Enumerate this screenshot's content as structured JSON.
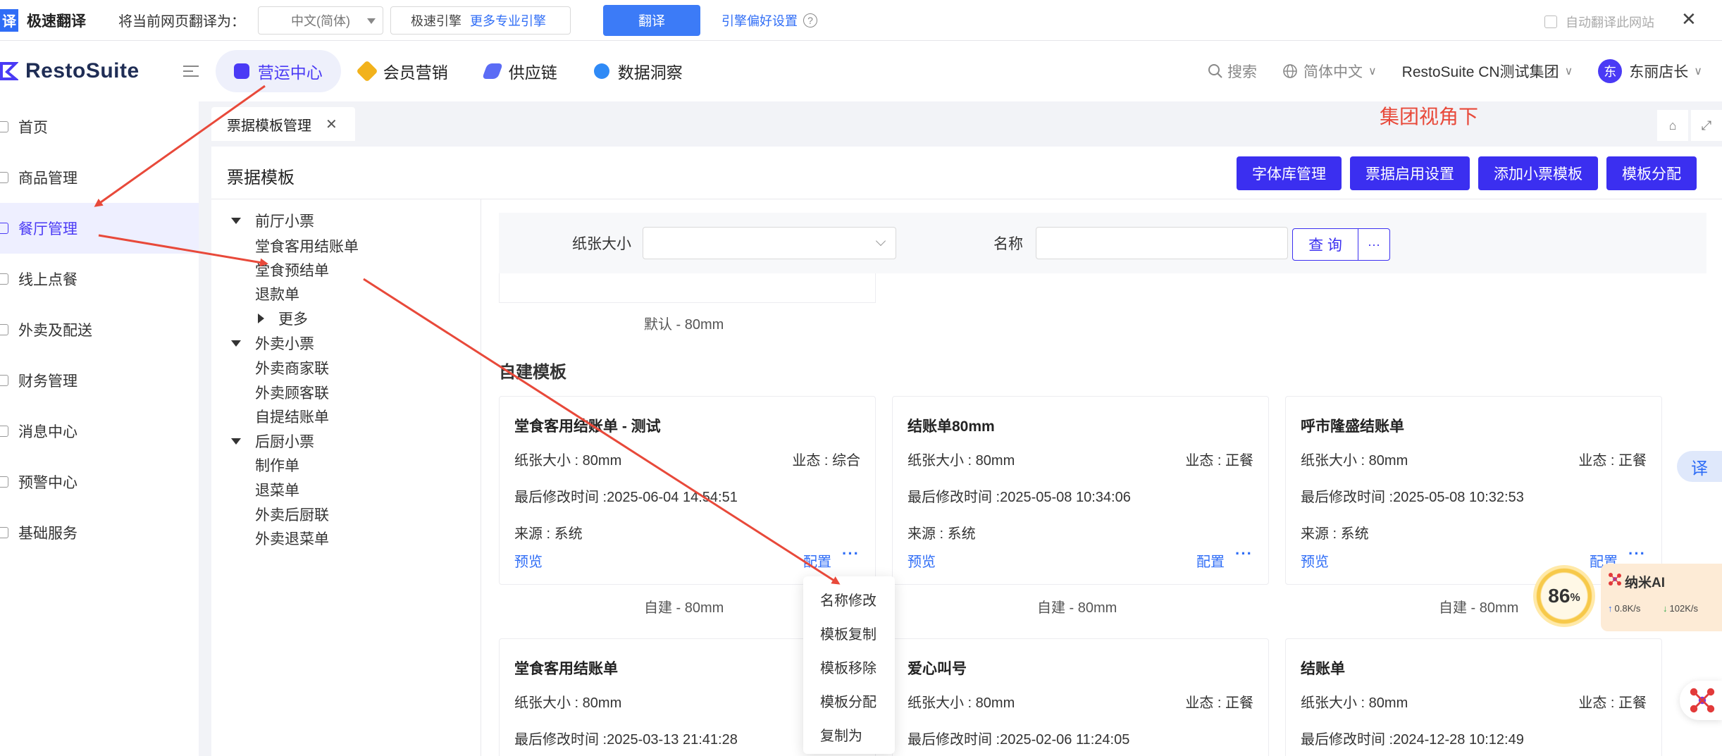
{
  "translate_bar": {
    "logo": "译",
    "name": "极速翻译",
    "hint": "将当前网页翻译为：",
    "language": "中文(简体)",
    "engine_label": "极速引擎",
    "engine_more": "更多专业引擎",
    "translate_button": "翻译",
    "preference": "引擎偏好设置",
    "help": "?",
    "auto_translate": "自动翻译此网站",
    "close": "✕"
  },
  "header": {
    "brand": "RestoSuite",
    "tabs": [
      {
        "label": "营运中心",
        "color": "#4a3af5"
      },
      {
        "label": "会员营销",
        "color": "#f2b21b"
      },
      {
        "label": "供应链",
        "color": "#5b6cf5"
      },
      {
        "label": "数据洞察",
        "color": "#2f8af6"
      }
    ],
    "search": "搜索",
    "language": "简体中文",
    "group": "RestoSuite CN测试集团",
    "avatar": "东",
    "user": "东丽店长"
  },
  "sidebar": {
    "items": [
      {
        "label": "首页"
      },
      {
        "label": "商品管理"
      },
      {
        "label": "餐厅管理"
      },
      {
        "label": "线上点餐"
      },
      {
        "label": "外卖及配送"
      },
      {
        "label": "财务管理"
      },
      {
        "label": "消息中心"
      },
      {
        "label": "预警中心"
      },
      {
        "label": "基础服务"
      }
    ]
  },
  "page_tab": {
    "label": "票据模板管理",
    "close": "✕"
  },
  "annotation": "集团视角下",
  "panel": {
    "title": "票据模板",
    "actions": [
      "字体库管理",
      "票据启用设置",
      "添加小票模板",
      "模板分配"
    ]
  },
  "tree": {
    "groups": [
      {
        "label": "前厅小票",
        "children": [
          "堂食客用结账单",
          "堂食预结单",
          "退款单"
        ],
        "more": "更多"
      },
      {
        "label": "外卖小票",
        "children": [
          "外卖商家联",
          "外卖顾客联",
          "自提结账单"
        ]
      },
      {
        "label": "后厨小票",
        "children": [
          "制作单",
          "退菜单",
          "外卖后厨联",
          "外卖退菜单"
        ]
      }
    ]
  },
  "filter": {
    "paper_label": "纸张大小",
    "name_label": "名称",
    "query": "查 询",
    "more": "···"
  },
  "default_tag": "默认 - 80mm",
  "section_title": "自建模板",
  "cards": [
    {
      "title": "堂食客用结账单 - 测试",
      "size": "纸张大小 : 80mm",
      "biz": "业态 : 综合",
      "modified": "最后修改时间 :2025-06-04 14:54:51",
      "source": "来源 : 系统",
      "preview": "预览",
      "config": "配置",
      "more": "···",
      "tag": "自建 - 80mm"
    },
    {
      "title": "结账单80mm",
      "size": "纸张大小 : 80mm",
      "biz": "业态 : 正餐",
      "modified": "最后修改时间 :2025-05-08 10:34:06",
      "source": "来源 : 系统",
      "preview": "预览",
      "config": "配置",
      "more": "···",
      "tag": "自建 - 80mm"
    },
    {
      "title": "呼市隆盛结账单",
      "size": "纸张大小 : 80mm",
      "biz": "业态 : 正餐",
      "modified": "最后修改时间 :2025-05-08 10:32:53",
      "source": "来源 : 系统",
      "preview": "预览",
      "config": "配置",
      "more": "···",
      "tag": "自建 - 80mm"
    },
    {
      "title": "堂食客用结账单",
      "size": "纸张大小 : 80mm",
      "biz": "业",
      "modified": "最后修改时间 :2025-03-13 21:41:28"
    },
    {
      "title": "爱心叫号",
      "size": "纸张大小 : 80mm",
      "biz": "业态 : 正餐",
      "modified": "最后修改时间 :2025-02-06 11:24:05"
    },
    {
      "title": "结账单",
      "size": "纸张大小 : 80mm",
      "biz": "业态 : 正餐",
      "modified": "最后修改时间 :2024-12-28 10:12:49"
    }
  ],
  "menu": {
    "items": [
      "名称修改",
      "模板复制",
      "模板移除",
      "模板分配",
      "复制为"
    ]
  },
  "widgets": {
    "translate": "译",
    "ai_percent": "86",
    "ai_unit": "%",
    "ai_name": "纳米AI",
    "up": "0.8K/s",
    "down": "102K/s"
  }
}
